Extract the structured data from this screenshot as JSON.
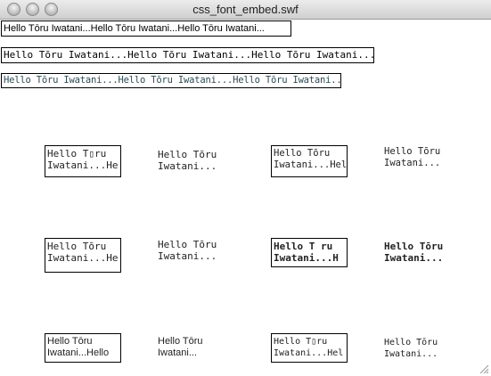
{
  "window": {
    "title": "css_font_embed.swf"
  },
  "fields": {
    "sans": "Hello Tōru Iwatani...Hello Tōru Iwatani...Hello Tōru Iwatani...",
    "mono": "Hello Tōru Iwatani...Hello Tōru Iwatani...Hello Tōru Iwatani...",
    "embed": "Hello Tōru Iwatani...Hello Tōru Iwatani...Hello Tōru Iwatani..."
  },
  "grid": {
    "r1c1": "Hello T▯ru\nIwatani...He",
    "r1c2": "Hello Tōru\nIwatani...",
    "r1c3": "Hello Tōru\nIwatani...Hel",
    "r1c4": "Hello Tōru\nIwatani...",
    "r2c1": "Hello Tōru\nIwatani...He",
    "r2c2": "Hello Tōru\nIwatani...",
    "r2c3": "Hello T ru\nIwatani...H",
    "r2c4": "Hello Tōru\nIwatani...",
    "r3c1": "Hello Tōru\nIwatani...Hello",
    "r3c2": "Hello Tōru\nIwatani...",
    "r3c3": "Hello T▯ru\nIwatani...Hel",
    "r3c4": "Hello Tōru\nIwatani..."
  }
}
